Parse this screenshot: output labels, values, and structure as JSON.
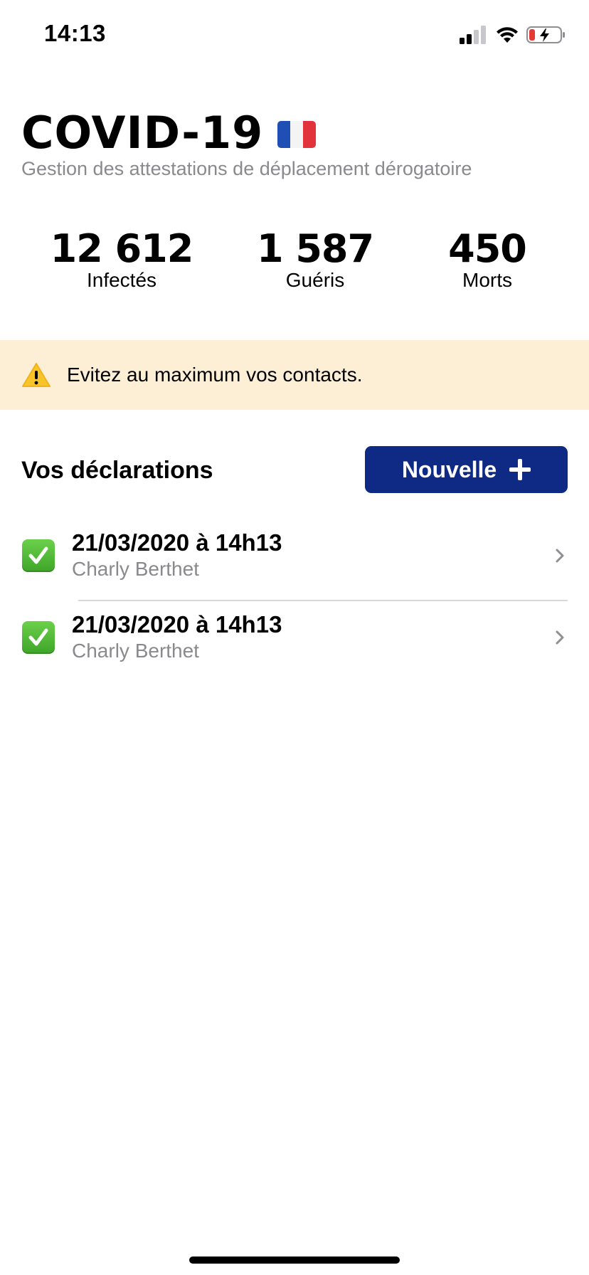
{
  "status_bar": {
    "time": "14:13",
    "icons": [
      "signal-icon",
      "wifi-icon",
      "battery-charging-icon"
    ]
  },
  "header": {
    "title": "COVID-19",
    "flag": "france-flag-icon",
    "subtitle": "Gestion des attestations de déplacement dérogatoire"
  },
  "stats": [
    {
      "value": "12 612",
      "label": "Infectés"
    },
    {
      "value": "1 587",
      "label": "Guéris"
    },
    {
      "value": "450",
      "label": "Morts"
    }
  ],
  "banner": {
    "icon": "warning-icon",
    "text": "Evitez au maximum vos contacts.",
    "background": "#fcefd6"
  },
  "declarations": {
    "title": "Vos déclarations",
    "new_button_label": "Nouvelle",
    "button_color": "#0e2a84",
    "items": [
      {
        "date": "21/03/2020 à 14h13",
        "name": "Charly Berthet",
        "icon": "check-icon"
      },
      {
        "date": "21/03/2020 à 14h13",
        "name": "Charly Berthet",
        "icon": "check-icon"
      }
    ]
  }
}
